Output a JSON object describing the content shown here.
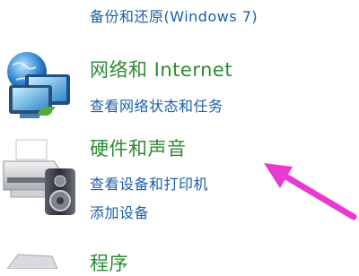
{
  "control_panel": {
    "backup": {
      "link": "备份和还原(Windows 7)"
    },
    "network": {
      "icon": "network-icon",
      "title": "网络和 Internet",
      "links": [
        "查看网络状态和任务"
      ]
    },
    "hardware": {
      "icon": "printer-speaker-icon",
      "title": "硬件和声音",
      "links": [
        "查看设备和打印机",
        "添加设备"
      ]
    },
    "programs": {
      "icon": "programs-icon",
      "title": "程序"
    }
  },
  "annotation": {
    "icon": "pink-arrow-icon",
    "color": "#e83ad0"
  }
}
